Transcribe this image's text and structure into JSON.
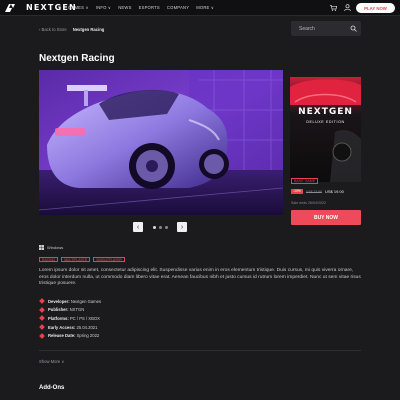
{
  "header": {
    "brand": "NEXTGEN",
    "nav": [
      "GAMES ∨",
      "INFO ∨",
      "NEWS",
      "ESPORTS",
      "COMPANY",
      "MORE ∨"
    ],
    "play_label": "PLAY NOW"
  },
  "breadcrumb": {
    "back": "‹  Back to Store",
    "current": "Nextgen Racing"
  },
  "search": {
    "placeholder": "Search"
  },
  "page": {
    "title": "Nextgen Racing"
  },
  "boxart": {
    "title": "NEXTGEN",
    "subtitle": "DELUXE EDITION"
  },
  "purchase": {
    "edition": "BASE GAME",
    "discount": "-10%",
    "old_price": "US$ 23.99",
    "price": "US$ 19.00",
    "sale_end": "Sale ends 26/04/2022",
    "buy_label": "BUY NOW"
  },
  "carousel": {
    "prev": "‹",
    "next": "›",
    "slides": 3,
    "active": 1
  },
  "platform": {
    "label": "Windows"
  },
  "tags": [
    "RACING",
    "MULTIPLAYER",
    "SINGLEPLAYER"
  ],
  "description": "Lorem ipsum dolor sit amet, consectetur adipiscing elit. Suspendisse varius enim in eros elementum tristique. Duis cursus, mi quis viverra ornare, eros dolor interdum nulla, ut commodo diam libero vitae erat. Aenean faucibus nibh et justo cursus id rutrum lorem imperdiet. Nunc ut sem vitae risus tristique posuere.",
  "facts": [
    {
      "key": "Developer:",
      "value": "Nextgen Games"
    },
    {
      "key": "Publisher:",
      "value": "NXTGN"
    },
    {
      "key": "Platforms:",
      "value": "PC / PS / XBOX"
    },
    {
      "key": "Early Access:",
      "value": "25.04.2021"
    },
    {
      "key": "Release Date:",
      "value": "Spring 2022"
    }
  ],
  "show_more": "Show More ∨",
  "addons_title": "Add-Ons",
  "colors": {
    "accent": "#e9414f",
    "bg": "#1b1b1e",
    "topbar": "#101012"
  },
  "icons": [
    "logo-icon",
    "cart-icon",
    "user-icon",
    "search-icon",
    "windows-icon",
    "diamond-bullet-icon"
  ]
}
